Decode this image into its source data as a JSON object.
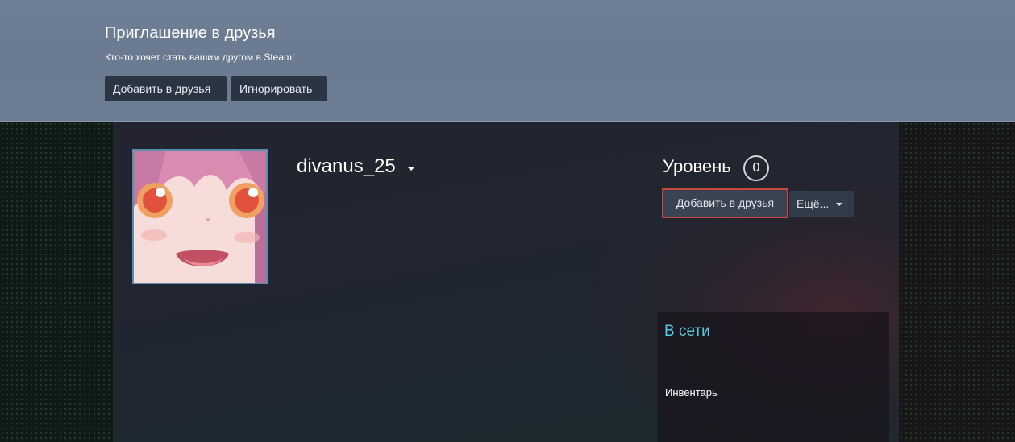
{
  "invite": {
    "title": "Приглашение в друзья",
    "subtitle": "Кто-то хочет стать вашим другом в Steam!",
    "add_label": "Добавить в друзья",
    "ignore_label": "Игнорировать"
  },
  "profile": {
    "username": "divanus_25",
    "level_label": "Уровень",
    "level_value": "0",
    "add_friend_label": "Добавить в друзья",
    "more_label": "Ещё...",
    "status": "В сети",
    "inventory_label": "Инвентарь"
  },
  "colors": {
    "banner": "#6e7f96",
    "online": "#57cbde",
    "highlight_border": "#c9473c"
  }
}
